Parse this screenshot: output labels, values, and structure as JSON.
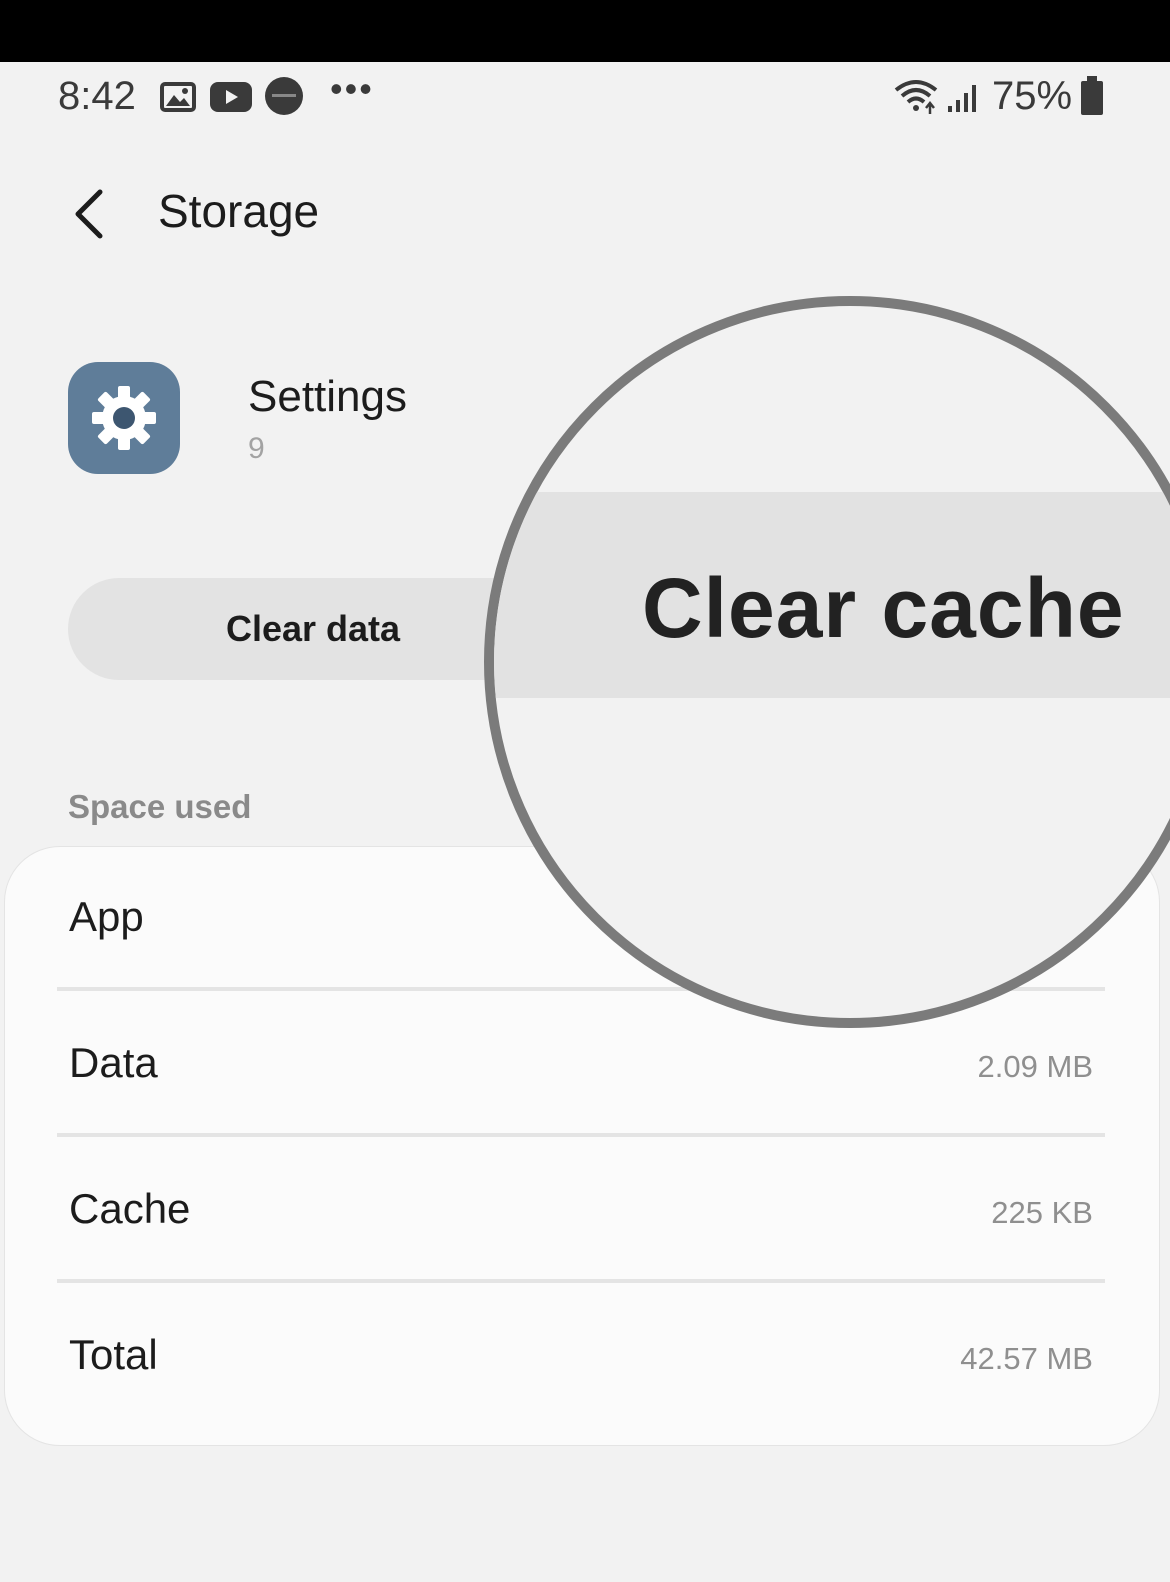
{
  "status_bar": {
    "time": "8:42",
    "left_icons": [
      "gallery-icon",
      "youtube-icon",
      "samsung-app-icon",
      "more-dots-icon"
    ],
    "more": "•••",
    "right_icons": [
      "wifi-icon",
      "signal-icon",
      "battery-icon"
    ],
    "battery": "75%"
  },
  "header": {
    "back_icon": "chevron-left-icon",
    "title": "Storage"
  },
  "app": {
    "icon": "gear-icon",
    "icon_color": "#5f7d99",
    "name": "Settings",
    "version": "9"
  },
  "actions": {
    "clear_data": "Clear data",
    "clear_cache": "Clear cache"
  },
  "space_used": {
    "section_label": "Space used",
    "rows": [
      {
        "label": "App",
        "value": ""
      },
      {
        "label": "Data",
        "value": "2.09 MB"
      },
      {
        "label": "Cache",
        "value": "225 KB"
      },
      {
        "label": "Total",
        "value": "42.57 MB"
      }
    ]
  }
}
